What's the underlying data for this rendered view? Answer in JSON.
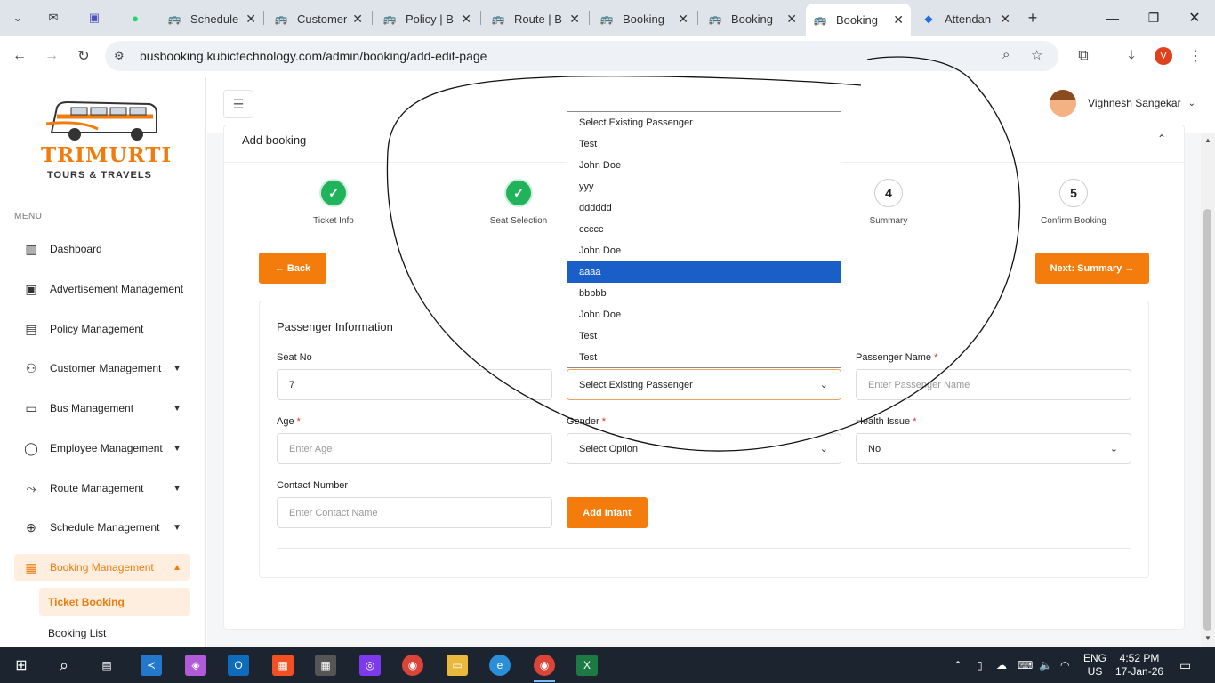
{
  "browser": {
    "tabs": [
      {
        "title": "",
        "icon": "outlook-icon"
      },
      {
        "title": "",
        "icon": "teams-icon"
      },
      {
        "title": "",
        "icon": "whatsapp-icon"
      },
      {
        "title": "Schedule",
        "icon": "bus-icon"
      },
      {
        "title": "Customer",
        "icon": "bus-icon"
      },
      {
        "title": "Policy | B",
        "icon": "bus-icon"
      },
      {
        "title": "Route | B",
        "icon": "bus-icon"
      },
      {
        "title": "Booking",
        "icon": "bus-icon"
      },
      {
        "title": "Booking",
        "icon": "bus-icon"
      },
      {
        "title": "Booking",
        "icon": "bus-icon"
      },
      {
        "title": "Attendan",
        "icon": "attendance-icon"
      }
    ],
    "url": "busbooking.kubictechnology.com/admin/booking/add-edit-page",
    "profile_initial": "V"
  },
  "sidebar": {
    "brand": "TRIMURTI",
    "brand_sub": "TOURS & TRAVELS",
    "menu_label": "MENU",
    "items": [
      {
        "label": "Dashboard",
        "icon": "chart-icon"
      },
      {
        "label": "Advertisement Management",
        "icon": "ad-icon"
      },
      {
        "label": "Policy Management",
        "icon": "policy-icon"
      },
      {
        "label": "Customer Management",
        "icon": "customers-icon"
      },
      {
        "label": "Bus Management",
        "icon": "bus-icon"
      },
      {
        "label": "Employee Management",
        "icon": "employee-icon"
      },
      {
        "label": "Route Management",
        "icon": "route-icon"
      },
      {
        "label": "Schedule Management",
        "icon": "schedule-icon"
      },
      {
        "label": "Booking Management",
        "icon": "booking-icon"
      }
    ],
    "subitems": [
      "Ticket Booking",
      "Booking List"
    ]
  },
  "header": {
    "user_name": "Vighnesh Sangekar"
  },
  "card": {
    "title": "Add booking",
    "steps": [
      {
        "num": "✓",
        "label": "Ticket Info"
      },
      {
        "num": "✓",
        "label": "Seat Selection"
      },
      {
        "num": "4",
        "label": "Summary"
      },
      {
        "num": "5",
        "label": "Confirm Booking"
      }
    ],
    "back_label": "← Back",
    "next_label": "Next: Summary →",
    "section_title": "Passenger Information",
    "seat_label": "Seat No",
    "seat_value": "7",
    "existing_value": "Select Existing Passenger",
    "name_label": "Passenger Name",
    "name_placeholder": "Enter Passenger Name",
    "age_label": "Age",
    "age_placeholder": "Enter Age",
    "gender_label": "Gender",
    "gender_value": "Select Option",
    "health_label": "Health Issue",
    "health_value": "No",
    "contact_label": "Contact Number",
    "contact_placeholder": "Enter Contact Name",
    "infant_label": "Add Infant",
    "required_mark": "*"
  },
  "dropdown_options": [
    "Select Existing Passenger",
    "Test",
    "John Doe",
    "yyy",
    "dddddd",
    "ccccc",
    "John Doe",
    "aaaa",
    "bbbbb",
    "John Doe",
    "Test",
    "Test"
  ],
  "dropdown_selected_index": 7,
  "taskbar": {
    "lang": "ENG",
    "region": "US",
    "time": "4:52 PM",
    "date": "17-Jan-26"
  },
  "colors": {
    "accent": "#f47c0c",
    "step_done": "#21b25c",
    "dropdown_highlight": "#1a5fc8"
  }
}
